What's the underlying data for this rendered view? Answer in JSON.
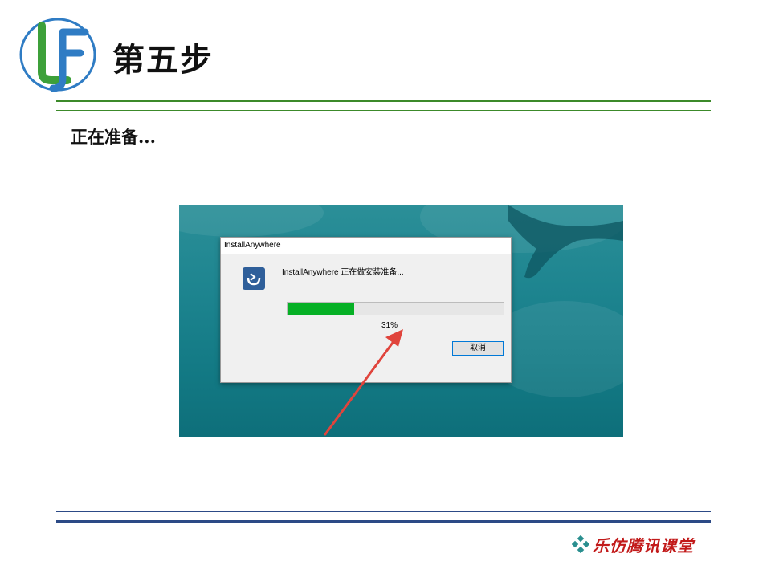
{
  "slide": {
    "title": "第五步",
    "subtitle": "正在准备..."
  },
  "dialog": {
    "window_title": "InstallAnywhere",
    "message": "InstallAnywhere 正在做安装准备...",
    "progress_percent": 31,
    "progress_label": "31%",
    "cancel_label": "取消"
  },
  "footer": {
    "brand": "乐仿腾讯课堂"
  },
  "colors": {
    "rule_green": "#3c8a2a",
    "rule_blue": "#2c4a86",
    "progress_green": "#06b025",
    "brand_red": "#c21a1a",
    "arrow_red": "#e0443c"
  }
}
